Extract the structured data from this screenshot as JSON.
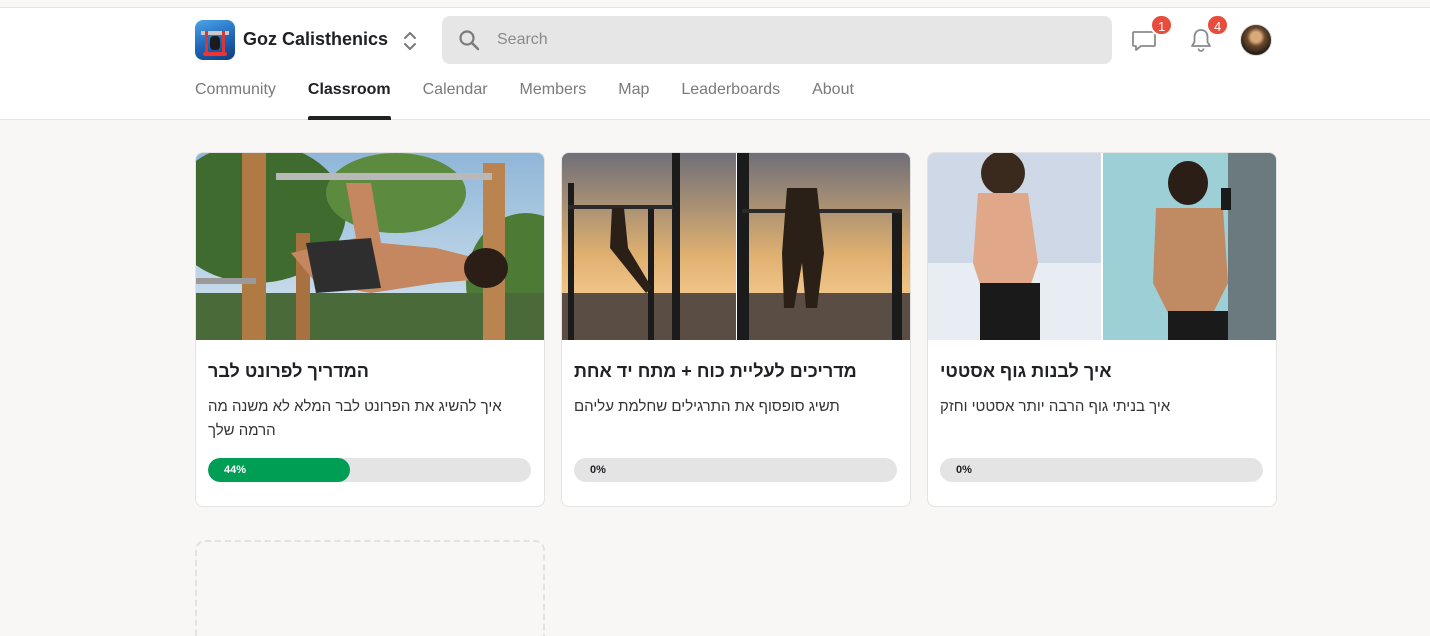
{
  "header": {
    "brand": "Goz Calisthenics",
    "search": {
      "placeholder": "Search",
      "value": ""
    },
    "chat_badge": "1",
    "notifications_badge": "4"
  },
  "tabs": [
    {
      "label": "Community",
      "active": false
    },
    {
      "label": "Classroom",
      "active": true
    },
    {
      "label": "Calendar",
      "active": false
    },
    {
      "label": "Members",
      "active": false
    },
    {
      "label": "Map",
      "active": false
    },
    {
      "label": "Leaderboards",
      "active": false
    },
    {
      "label": "About",
      "active": false
    }
  ],
  "courses": [
    {
      "title": "המדריך לפרונט לבר",
      "description": "איך להשיג את הפרונט לבר המלא לא משנה מה הרמה שלך",
      "progress": 44,
      "progress_label": "44%"
    },
    {
      "title": "מדריכים לעליית כוח + מתח יד אחת",
      "description": "תשיג סופסוף את התרגילים שחלמת עליהם",
      "progress": 0,
      "progress_label": "0%"
    },
    {
      "title": "איך לבנות גוף אסטטי",
      "description": "איך בניתי גוף הרבה יותר אסטטי וחזק",
      "progress": 0,
      "progress_label": "0%"
    }
  ],
  "colors": {
    "progress_fill": "#009e55",
    "badge": "#e74c3c",
    "active_tab": "#202124"
  }
}
